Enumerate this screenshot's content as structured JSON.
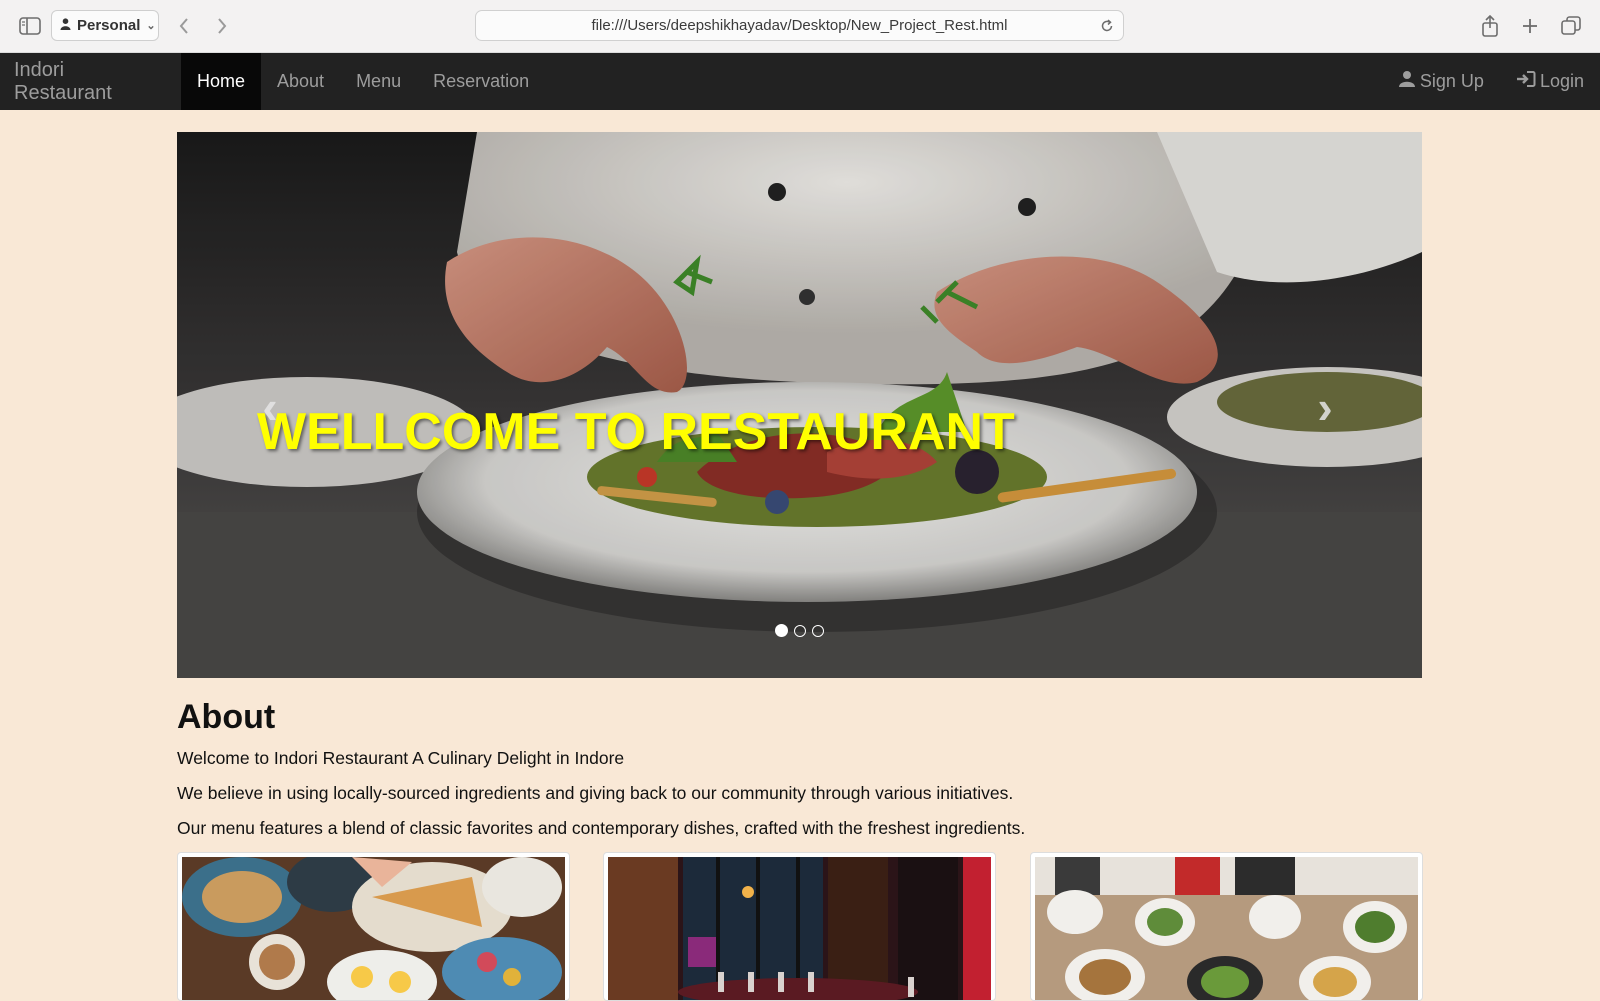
{
  "browser": {
    "profile": "Personal",
    "url": "file:///Users/deepshikhayadav/Desktop/New_Project_Rest.html"
  },
  "navbar": {
    "brand": "Indori Restaurant",
    "items": [
      {
        "label": "Home",
        "active": true
      },
      {
        "label": "About"
      },
      {
        "label": "Menu"
      },
      {
        "label": "Reservation"
      }
    ],
    "signup": "Sign Up",
    "login": "Login"
  },
  "carousel": {
    "caption": "WELLCOME TO RESTAURANT",
    "slides": 3,
    "active_slide": 1,
    "caption_color": "#ffff00"
  },
  "about": {
    "title": "About",
    "paragraphs": [
      "Welcome to Indori Restaurant A Culinary Delight in Indore",
      "We believe in using locally-sourced ingredients and giving back to our community through various initiatives.",
      "Our menu features a blend of classic favorites and contemporary dishes, crafted with the freshest ingredients."
    ]
  },
  "colors": {
    "page_background": "#f9e8d6",
    "navbar_background": "#222222"
  }
}
